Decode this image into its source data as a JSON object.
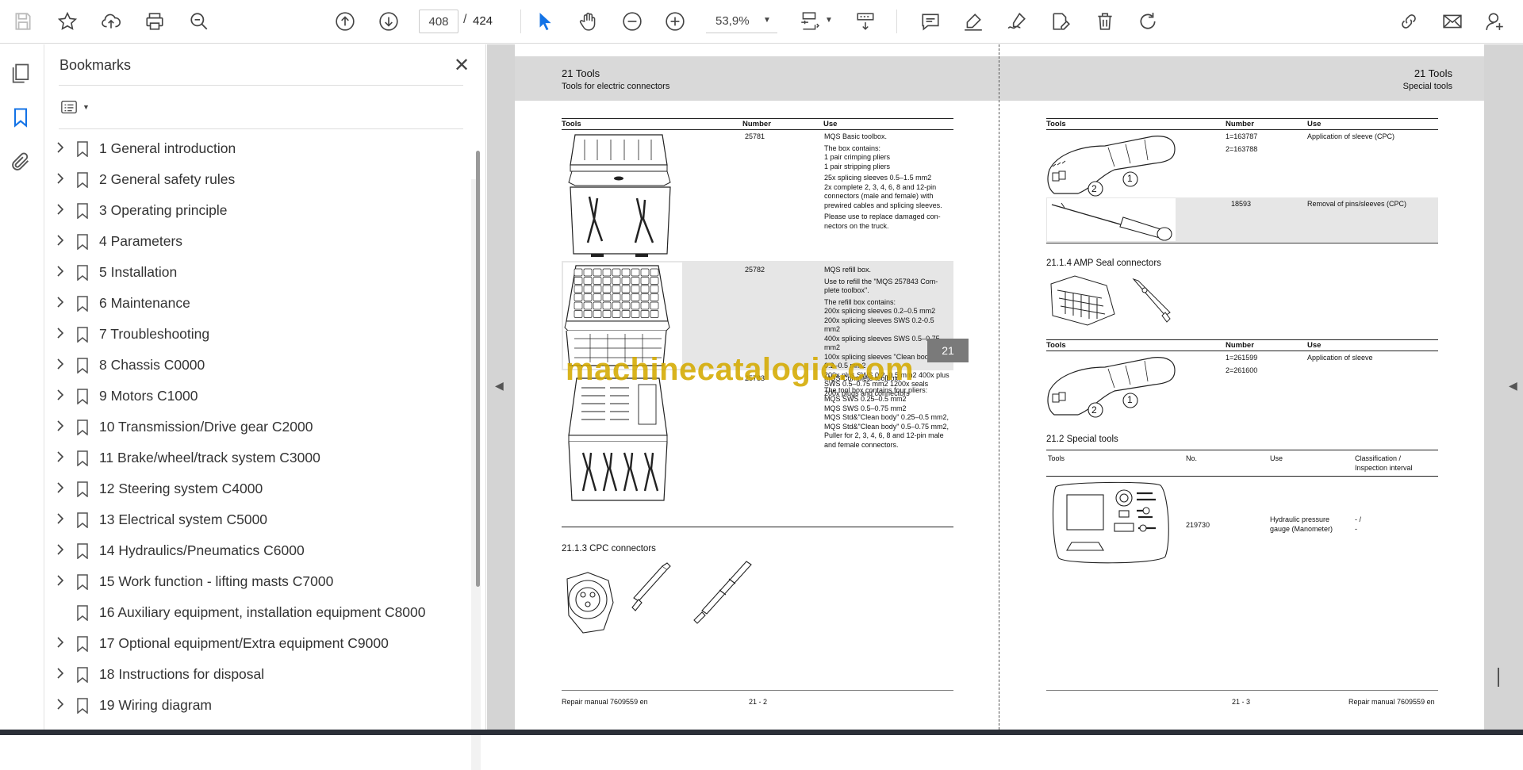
{
  "toolbar": {
    "current_page": "408",
    "page_separator": "/",
    "total_pages": "424",
    "zoom": "53,9%"
  },
  "sidebar": {
    "title": "Bookmarks",
    "items": [
      {
        "label": "1 General introduction",
        "expandable": true
      },
      {
        "label": "2 General safety rules",
        "expandable": true
      },
      {
        "label": "3 Operating principle",
        "expandable": true
      },
      {
        "label": "4 Parameters",
        "expandable": true
      },
      {
        "label": "5 Installation",
        "expandable": true
      },
      {
        "label": "6 Maintenance",
        "expandable": true
      },
      {
        "label": "7 Troubleshooting",
        "expandable": true
      },
      {
        "label": "8 Chassis C0000",
        "expandable": true
      },
      {
        "label": "9 Motors C1000",
        "expandable": true
      },
      {
        "label": "10 Transmission/Drive gear C2000",
        "expandable": true
      },
      {
        "label": "11 Brake/wheel/track system C3000",
        "expandable": true
      },
      {
        "label": "12 Steering system C4000",
        "expandable": true
      },
      {
        "label": "13 Electrical system C5000",
        "expandable": true
      },
      {
        "label": "14 Hydraulics/Pneumatics C6000",
        "expandable": true
      },
      {
        "label": "15 Work function - lifting masts C7000",
        "expandable": true
      },
      {
        "label": "16 Auxiliary equipment, installation equipment C8000",
        "expandable": false
      },
      {
        "label": "17 Optional equipment/Extra equipment C9000",
        "expandable": true
      },
      {
        "label": "18 Instructions for disposal",
        "expandable": true
      },
      {
        "label": "19 Wiring diagram",
        "expandable": true
      }
    ]
  },
  "left_page": {
    "header_title": "21 Tools",
    "header_subtitle": "Tools for electric connectors",
    "col_tools": "Tools",
    "col_number": "Number",
    "col_use": "Use",
    "rows": [
      {
        "number": "25781",
        "use": [
          "MQS Basic toolbox.",
          "The box contains:",
          "1 pair crimping pliers",
          "1 pair stripping pliers",
          "25x splicing sleeves 0.5–1.5 mm2",
          "2x complete 2, 3, 4, 6, 8 and 12-pin",
          "connectors (male and female) with",
          "prewired cables and splicing sleeves.",
          "Please use to replace damaged con-",
          "nectors on the truck."
        ]
      },
      {
        "number": "25782",
        "use": [
          "MQS refill box.",
          "Use to refill the \"MQS 257843 Com-",
          "plete toolbox\".",
          "The refill box contains:",
          "200x splicing sleeves 0.2–0.5 mm2",
          "200x splicing sleeves SWS 0.2-0.5",
          "mm2",
          "400x splicing sleeves SWS 0.5–0.75",
          "mm2",
          "100x splicing sleeves \"Clean body\"",
          "0.2–0.5 mm2",
          "200x plus SWS 0.2–0.5 mm2 400x plus",
          "SWS 0.5–0.75 mm2 1200x seals",
          "200x plugs and connectors"
        ]
      },
      {
        "number": "25783",
        "use": [
          "MQS Complete toolbox.",
          "The tool box contains four pliers:",
          "MQS SWS 0.25–0.5 mm2",
          "MQS SWS 0.5–0.75 mm2",
          "MQS Std&\"Clean body\" 0.25–0.5 mm2,",
          "MQS Std&\"Clean body\" 0.5–0.75 mm2,",
          "Puller for 2, 3, 4, 6, 8 and 12-pin male",
          "and female connectors."
        ]
      }
    ],
    "section_cpc": "21.1.3 CPC connectors",
    "footer_left": "Repair manual 7609559 en",
    "footer_page": "21 - 2"
  },
  "right_page": {
    "header_title": "21 Tools",
    "header_subtitle": "Special tools",
    "col_tools": "Tools",
    "col_number": "Number",
    "col_use": "Use",
    "cpc_rows": [
      {
        "number": [
          "1=163787",
          "2=163788"
        ],
        "use": "Application of sleeve (CPC)"
      },
      {
        "number": [
          "18593"
        ],
        "use": "Removal of pins/sleeves (CPC)"
      }
    ],
    "section_amp": "21.1.4 AMP Seal connectors",
    "amp_rows": [
      {
        "number": [
          "1=261599",
          "2=261600"
        ],
        "use": "Application of sleeve"
      }
    ],
    "section_special": "21.2 Special tools",
    "special_cols": {
      "tools": "Tools",
      "no": "No.",
      "use": "Use",
      "class": "Classification /",
      "class2": "Inspection interval"
    },
    "special_rows": [
      {
        "no": "219730",
        "use": [
          "Hydraulic pressure",
          "gauge (Manometer)"
        ],
        "classification": [
          "- /",
          "-"
        ]
      }
    ],
    "callout_1": "1",
    "callout_2": "2",
    "footer_page": "21 - 3",
    "footer_right": "Repair manual 7609559 en"
  },
  "chapter_tab": "21",
  "watermark": "machinecatalogic.com"
}
